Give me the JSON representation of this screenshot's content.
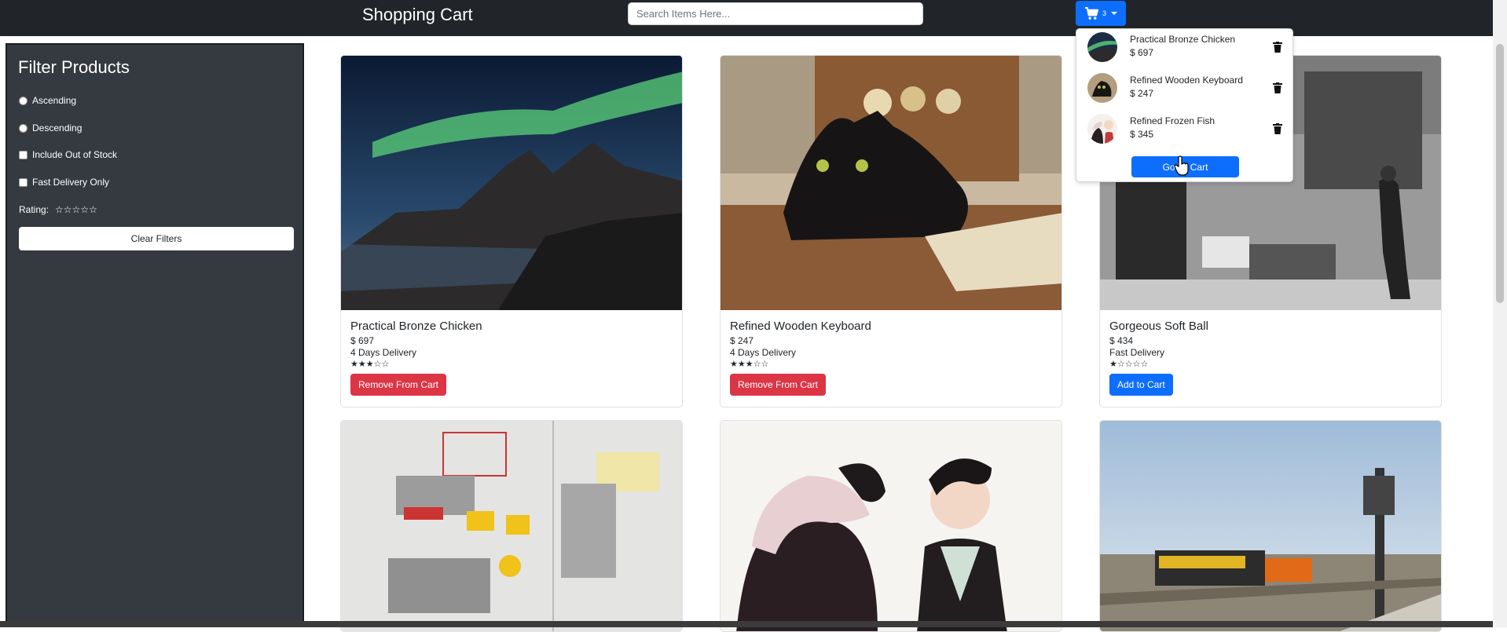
{
  "navbar": {
    "brand": "Shopping Cart",
    "search_placeholder": "Search Items Here...",
    "cart_count": "3"
  },
  "sidebar": {
    "title": "Filter Products",
    "options": [
      "Ascending",
      "Descending",
      "Include Out of Stock",
      "Fast Delivery Only"
    ],
    "rating_label": "Rating:",
    "rating_stars": "☆☆☆☆☆",
    "clear_button": "Clear Filters"
  },
  "products": [
    {
      "name": "Practical Bronze Chicken",
      "price": "$ 697",
      "delivery": "4 Days Delivery",
      "stars": "★★★☆☆",
      "rating": 3,
      "action": "Remove From Cart"
    },
    {
      "name": "Refined Wooden Keyboard",
      "price": "$ 247",
      "delivery": "4 Days Delivery",
      "stars": "★★★☆☆",
      "rating": 3,
      "action": "Remove From Cart"
    },
    {
      "name": "Gorgeous Soft Ball",
      "price": "$ 434",
      "delivery": "Fast Delivery",
      "stars": "★☆☆☆☆",
      "rating": 1,
      "action": "Add to Cart"
    }
  ],
  "cart_dropdown": {
    "items": [
      {
        "name": "Practical Bronze Chicken",
        "price": "$ 697"
      },
      {
        "name": "Refined Wooden Keyboard",
        "price": "$ 247"
      },
      {
        "name": "Refined Frozen Fish",
        "price": "$ 345"
      }
    ],
    "go_to_cart": "Go To Cart"
  },
  "colors": {
    "navbar": "#212529",
    "sidebar": "#343a40",
    "primary": "#0d6efd",
    "danger": "#dc3545"
  }
}
